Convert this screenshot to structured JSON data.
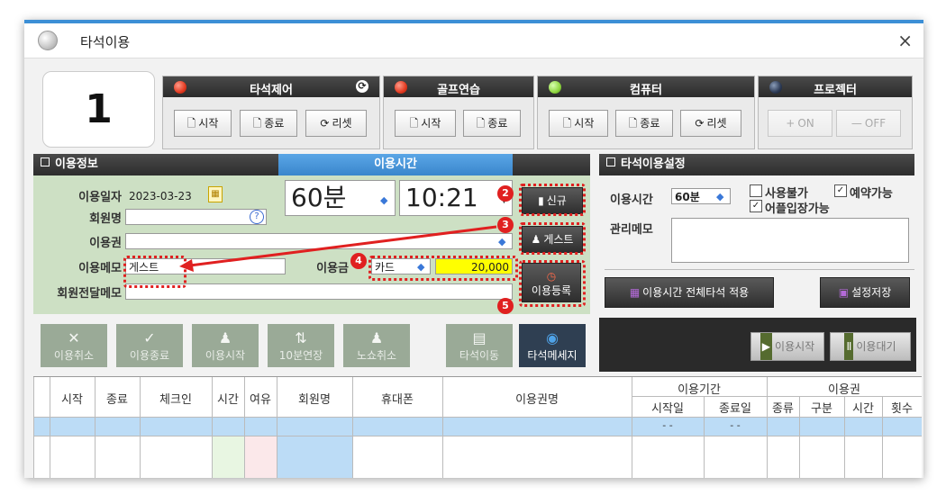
{
  "window": {
    "title": "타석이용",
    "close_label": "×"
  },
  "bay_number": "1",
  "groups": [
    {
      "title": "타석제어",
      "led": "red",
      "buttons": [
        "시작",
        "종료",
        "리셋"
      ]
    },
    {
      "title": "골프연습",
      "led": "red",
      "buttons": [
        "시작",
        "종료"
      ]
    },
    {
      "title": "컴퓨터",
      "led": "green",
      "buttons": [
        "시작",
        "종료",
        "리셋"
      ]
    },
    {
      "title": "프로젝터",
      "led": "dark",
      "buttons": [
        "ON",
        "OFF"
      ]
    }
  ],
  "usage_info": {
    "header": "이용정보",
    "time_header": "이용시간",
    "date_label": "이용일자",
    "date_value": "2023-03-23",
    "member_label": "회원명",
    "member_value": "",
    "pass_label": "이용권",
    "pass_value": "",
    "memo_label": "이용메모",
    "memo_value": "게스트",
    "fee_label": "이용금",
    "payment_method": "카드",
    "fee_value": "20,000",
    "delivery_memo_label": "회원전달메모",
    "delivery_memo_value": "",
    "duration_value": "60분",
    "start_time_value": "10:21",
    "btn_new": "신규",
    "btn_guest": "게스트",
    "btn_register": "이용등록"
  },
  "badges": [
    "2",
    "3",
    "4",
    "5"
  ],
  "action_buttons": [
    "이용취소",
    "이용종료",
    "이용시작",
    "10분연장",
    "노쇼취소",
    "타석이동",
    "타석메세지"
  ],
  "settings": {
    "header": "타석이용설정",
    "time_label": "이용시간",
    "time_value": "60분",
    "unavailable_label": "사용불가",
    "reservable_label": "예약가능",
    "member_entry_label": "어플입장가능",
    "memo_label": "관리메모",
    "apply_all_label": "이용시간 전체타석 적용",
    "save_label": "설정저장",
    "start_label": "이용시작",
    "wait_label": "이용대기"
  },
  "table": {
    "headers": [
      "시작",
      "종료",
      "체크인",
      "시간",
      "여유",
      "회원명",
      "휴대폰",
      "이용권명"
    ],
    "period_header": "이용기간",
    "period_sub": [
      "시작일",
      "종료일"
    ],
    "pass_header": "이용권",
    "pass_sub": [
      "종류",
      "구분",
      "시간",
      "횟수"
    ],
    "row_dash": [
      "- -",
      "- -"
    ]
  },
  "colors": {
    "accent": "#3c8fd6",
    "panel_green": "#cde0c4",
    "highlight_red": "#e02020",
    "fee_yellow": "#ffff00",
    "header_dark": "#333333"
  }
}
